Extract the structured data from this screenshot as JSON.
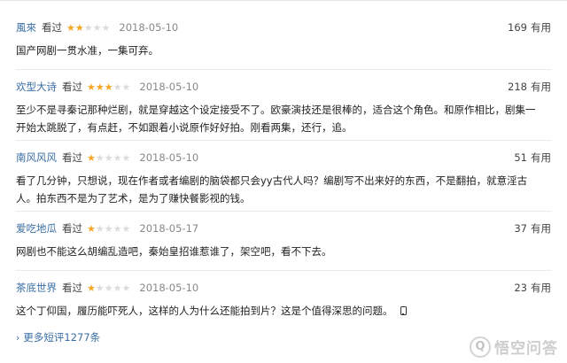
{
  "reviews": [
    {
      "user": "風來",
      "watched": "看过",
      "stars": 2,
      "date": "2018-05-10",
      "useful_count": "169",
      "useful_label": "有用",
      "lines": [
        "国产网剧一贯水准，一集可弃。"
      ]
    },
    {
      "user": "欢型大诗",
      "watched": "看过",
      "stars": 3,
      "date": "2018-05-10",
      "useful_count": "218",
      "useful_label": "有用",
      "lines": [
        "至少不是寻秦记那种烂剧，就是穿越这个设定接受不了。欧豪演技还是很棒的，适合这个角色。和原作相比，剧集一",
        "开始太跳脱了，有点赶，不如跟着小说原作好好拍。刚看两集，还行，追。"
      ]
    },
    {
      "user": "南风风风",
      "watched": "看过",
      "stars": 1,
      "date": "2018-05-10",
      "useful_count": "51",
      "useful_label": "有用",
      "lines": [
        "看了几分钟，只想说，现在作者或者编剧的脑袋都只会yy古代人吗？编剧写不出来好的东西，不是翻拍，就意淫古",
        "人。拍东西不是为了艺术，是为了赚快餐影视的钱。"
      ]
    },
    {
      "user": "爱吃地瓜",
      "watched": "看过",
      "stars": 1,
      "date": "2018-05-17",
      "useful_count": "37",
      "useful_label": "有用",
      "lines": [
        "网剧也不能这么胡编乱造吧，秦始皇招谁惹谁了，架空吧，看不下去。"
      ]
    },
    {
      "user": "茶底世界",
      "watched": "看过",
      "stars": 1,
      "date": "2018-05-10",
      "useful_count": "23",
      "useful_label": "有用",
      "lines": [
        "这个丁仰国，履历能吓死人，这样的人为什么还能拍到片？这是个值得深思的问题。"
      ]
    }
  ],
  "more_link": "更多短评1277条",
  "watermark": {
    "text": "悟空问答",
    "icon_char": "Q"
  },
  "colors": {
    "user": "#3a6ea5",
    "star_on": "#f5a623",
    "star_off": "#dcdcdc"
  }
}
